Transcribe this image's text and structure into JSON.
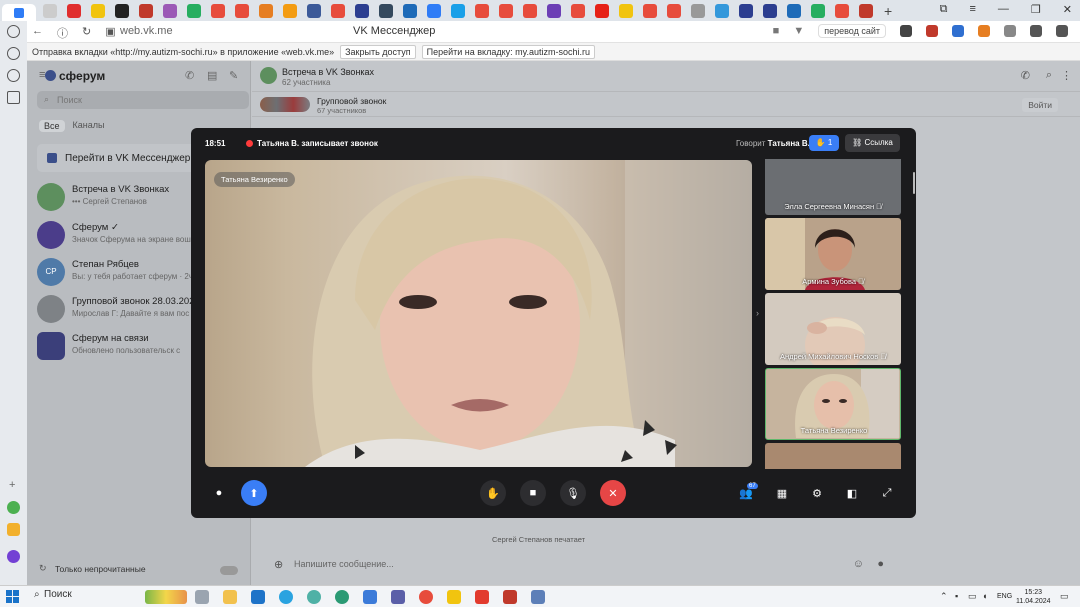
{
  "browser": {
    "url": "web.vk.me",
    "page_title": "VK Мессенджер",
    "translate_label": "перевод сайт",
    "notification": {
      "text": "Отправка вкладки «http://my.autizm-sochi.ru» в приложение «web.vk.me»",
      "close_label": "Закрыть доступ",
      "go_label": "Перейти на вкладку: my.autizm-sochi.ru"
    }
  },
  "sidebar": {
    "logo": "сферум",
    "search_placeholder": "Поиск",
    "tabs": [
      "Все",
      "Каналы"
    ],
    "goto_vk": "Перейти в VK Мессенджер",
    "chats": [
      {
        "name": "Встреча в VK Звонках",
        "preview": "••• Сергей Степанов",
        "color": "#5d8f5e"
      },
      {
        "name": "Сферум ✓",
        "preview": "Значок Сферума на экране вош",
        "color": "#4b3d8a"
      },
      {
        "name": "Степан Рябцев",
        "preview": "Вы: у тебя работает сферум · 2ч",
        "color": "#4f7aa8",
        "initials": "СР"
      },
      {
        "name": "Групповой звонок 28.03.2024",
        "preview": "Мирослав Г: Давайте я вам пос",
        "color": "#7e8286"
      },
      {
        "name": "Сферум на связи",
        "preview": "Обновлено пользовательск с",
        "color": "#3b3f7a"
      }
    ],
    "unread_only": "Только непрочитанные"
  },
  "conversation": {
    "title": "Встреча в VK Звонках",
    "subtitle": "62 участника",
    "call_title": "Групповой звонок",
    "call_subtitle": "67 участников",
    "join_label": "Войти",
    "composer_placeholder": "Напишите сообщение...",
    "typing": "Сергей Степанов печатает"
  },
  "call": {
    "time": "18:51",
    "recording": "Татьяна В. записывает звонок",
    "speaking_prefix": "Говорит",
    "speaking_name": "Татьяна В.",
    "hands_count": "1",
    "link_label": "Ссылка",
    "main_speaker": "Татьяна Везиренко",
    "participants_badge": "67",
    "tiles": [
      {
        "name": "Элла Сергеевна Минасян 🎙̸",
        "bg": "#6b6e72"
      },
      {
        "name": "Армина Зубова 🎙̸",
        "bg": "#b9a28a"
      },
      {
        "name": "Андрей Михайлович Носков 🎙̸",
        "bg": "#d3cabf"
      },
      {
        "name": "Татьяна Везиренко",
        "bg": "#c6b49e"
      },
      {
        "name": "",
        "bg": "#a9896f"
      }
    ]
  },
  "taskbar": {
    "search_label": "Поиск",
    "lang": "ENG",
    "time": "15:23",
    "date": "11.04.2024"
  }
}
